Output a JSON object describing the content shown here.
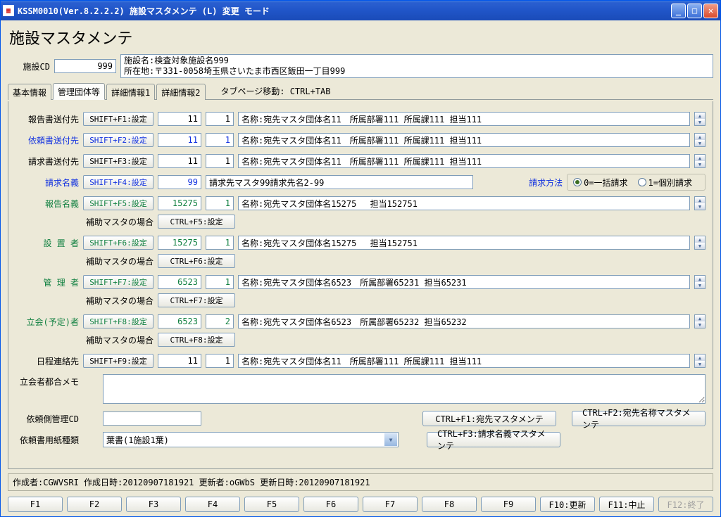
{
  "window": {
    "title": "KSSM0010(Ver.8.2.2.2) 施設マスタメンテ (L) 変更 モード"
  },
  "page_title": "施設マスタメンテ",
  "header": {
    "cd_label": "施設CD",
    "cd_value": "999",
    "name_line": "施設名:検査対象施設名999",
    "addr_line": "所在地:〒331-0058埼玉県さいたま市西区飯田一丁目999"
  },
  "tabs": {
    "t1": "基本情報",
    "t2": "管理団体等",
    "t3": "詳細情報1",
    "t4": "詳細情報2",
    "hint": "タブページ移動: CTRL+TAB"
  },
  "rows": {
    "houkoku": {
      "label": "報告書送付先",
      "btn": "SHIFT+F1:設定",
      "n1": "11",
      "n2": "1",
      "text": "名称:宛先マスタ団体名11　所属部署111 所属課111 担当111"
    },
    "irai": {
      "label": "依頼書送付先",
      "btn": "SHIFT+F2:設定",
      "n1": "11",
      "n2": "1",
      "text": "名称:宛先マスタ団体名11　所属部署111 所属課111 担当111"
    },
    "seikyu": {
      "label": "請求書送付先",
      "btn": "SHIFT+F3:設定",
      "n1": "11",
      "n2": "1",
      "text": "名称:宛先マスタ団体名11　所属部署111 所属課111 担当111"
    },
    "meigi": {
      "label": "請求名義",
      "btn": "SHIFT+F4:設定",
      "n1": "99",
      "text": "請求先マスタ99請求先名2-99",
      "method_label": "請求方法",
      "opt0": "0=一括請求",
      "opt1": "1=個別請求"
    },
    "hmeigi": {
      "label": "報告名義",
      "btn": "SHIFT+F5:設定",
      "n1": "15275",
      "n2": "1",
      "text": "名称:宛先マスタ団体名15275　 担当152751",
      "aux_label": "補助マスタの場合",
      "aux_btn": "CTRL+F5:設定"
    },
    "secchi": {
      "label": "設 置 者",
      "btn": "SHIFT+F6:設定",
      "n1": "15275",
      "n2": "1",
      "text": "名称:宛先マスタ団体名15275　 担当152751",
      "aux_label": "補助マスタの場合",
      "aux_btn": "CTRL+F6:設定"
    },
    "kanri": {
      "label": "管 理 者",
      "btn": "SHIFT+F7:設定",
      "n1": "6523",
      "n2": "1",
      "text": "名称:宛先マスタ団体名6523　所属部署65231 担当65231",
      "aux_label": "補助マスタの場合",
      "aux_btn": "CTRL+F7:設定"
    },
    "tachiai": {
      "label": "立会(予定)者",
      "btn": "SHIFT+F8:設定",
      "n1": "6523",
      "n2": "2",
      "text": "名称:宛先マスタ団体名6523　所属部署65232 担当65232",
      "aux_label": "補助マスタの場合",
      "aux_btn": "CTRL+F8:設定"
    },
    "nittei": {
      "label": "日程連絡先",
      "btn": "SHIFT+F9:設定",
      "n1": "11",
      "n2": "1",
      "text": "名称:宛先マスタ団体名11　所属部署111 所属課111 担当111"
    }
  },
  "memo": {
    "label": "立会者都合メモ"
  },
  "irai_cd": {
    "label": "依頼側管理CD"
  },
  "paper": {
    "label": "依頼書用紙種類",
    "value": "葉書(1施設1葉)"
  },
  "cbtns": {
    "b1": "CTRL+F1:宛先マスタメンテ",
    "b2": "CTRL+F2:宛先名称マスタメンテ",
    "b3": "CTRL+F3:請求名義マスタメンテ"
  },
  "status": "作成者:CGWVSRI 作成日時:20120907181921 更新者:oGWbS 更新日時:20120907181921",
  "fkeys": {
    "f1": "F1",
    "f2": "F2",
    "f3": "F3",
    "f4": "F4",
    "f5": "F5",
    "f6": "F6",
    "f7": "F7",
    "f8": "F8",
    "f9": "F9",
    "f10": "F10:更新",
    "f11": "F11:中止",
    "f12": "F12:終了"
  }
}
